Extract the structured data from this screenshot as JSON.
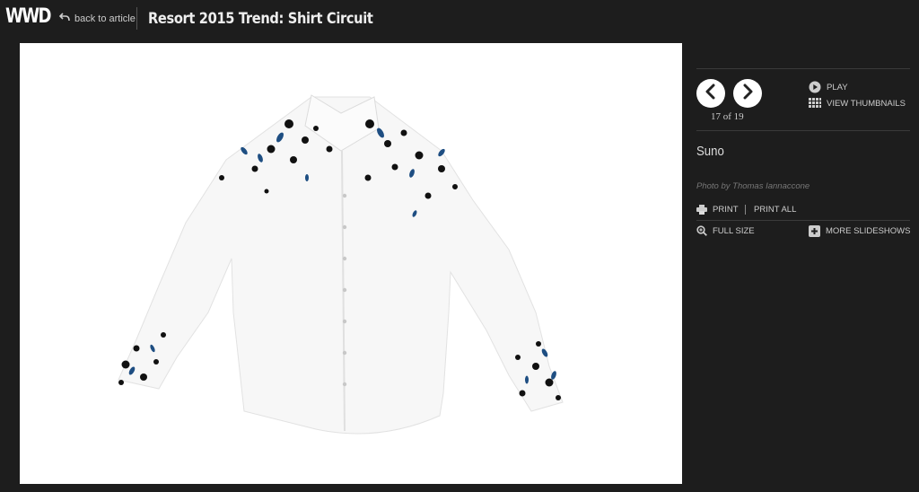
{
  "header": {
    "logo": "WWD",
    "back_label": "back to article",
    "title": "Resort 2015 Trend: Shirt Circuit"
  },
  "slideshow": {
    "counter": "17 of 19",
    "play_label": "PLAY",
    "thumbnails_label": "VIEW THUMBNAILS",
    "caption": "Suno",
    "credit": "Photo by Thomas Iannaccone",
    "print_label": "PRINT",
    "print_all_label": "PRINT ALL",
    "full_size_label": "FULL SIZE",
    "more_slideshows_label": "MORE SLIDESHOWS"
  },
  "icons": {
    "back": "curved-arrow-icon",
    "prev": "chevron-left-icon",
    "next": "chevron-right-icon",
    "play": "play-circle-icon",
    "thumbnails": "grid-icon",
    "print": "printer-icon",
    "full_size": "magnifier-icon",
    "more": "plus-square-icon"
  },
  "colors": {
    "background": "#1d1d1d",
    "stage": "#ffffff",
    "accent_feather_dark": "#111111",
    "accent_feather_blue": "#1e4e82"
  }
}
